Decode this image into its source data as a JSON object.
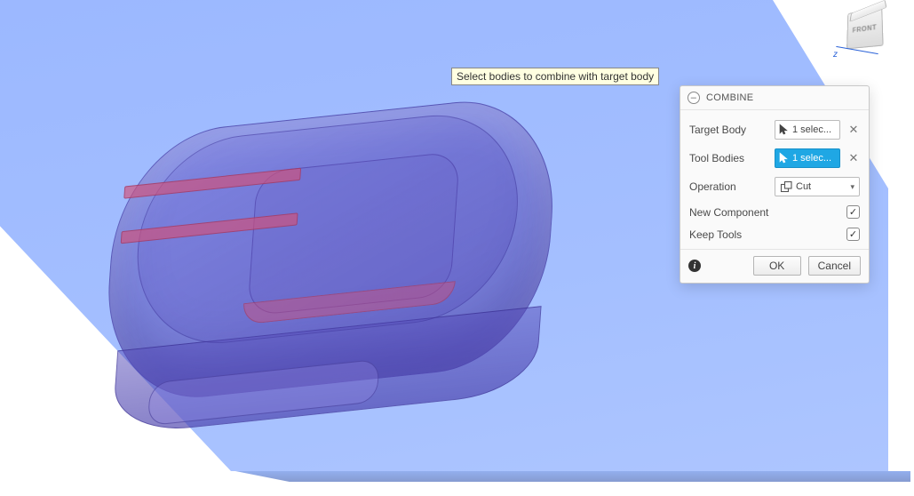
{
  "tooltip": {
    "text": "Select bodies to combine with target body"
  },
  "viewcube": {
    "front": "FRONT",
    "z_label": "z"
  },
  "panel": {
    "title": "COMBINE",
    "rows": {
      "target_body": {
        "label": "Target Body",
        "value": "1 selec..."
      },
      "tool_bodies": {
        "label": "Tool Bodies",
        "value": "1 selec..."
      },
      "operation": {
        "label": "Operation",
        "value": "Cut"
      },
      "new_component": {
        "label": "New Component",
        "checked": true
      },
      "keep_tools": {
        "label": "Keep Tools",
        "checked": true
      }
    },
    "footer": {
      "ok": "OK",
      "cancel": "Cancel"
    }
  }
}
